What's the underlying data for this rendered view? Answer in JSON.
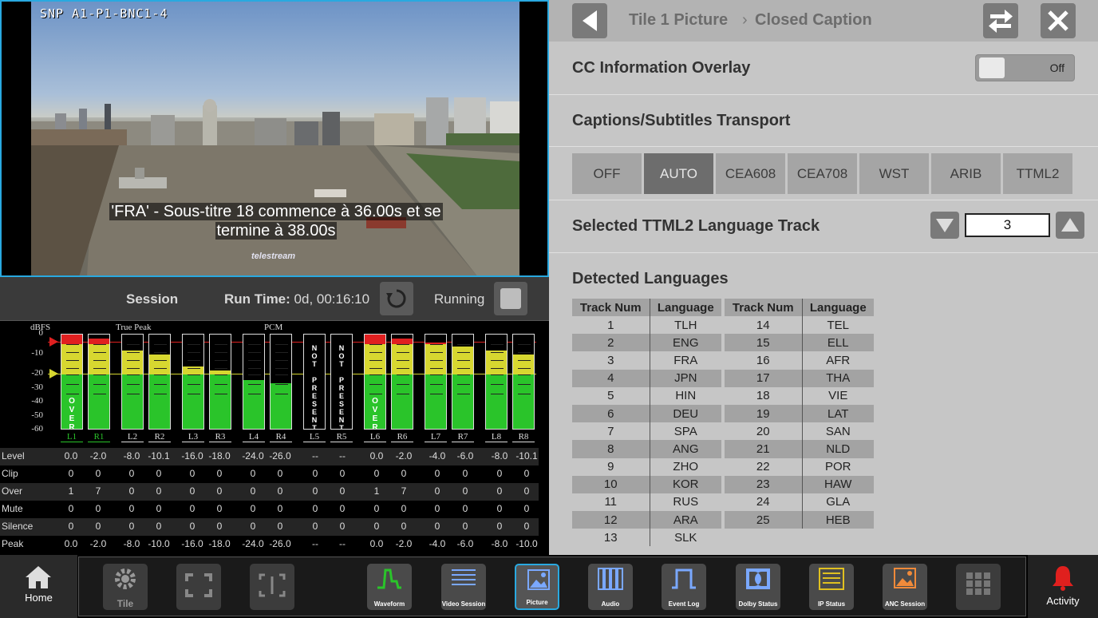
{
  "picture": {
    "source_label": "SNP A1-P1-BNC1-4",
    "caption_line1": "'FRA' - Sous-titre 18 commence à 36.00s et se",
    "caption_line2": "termine à 38.00s",
    "watermark": "telestream"
  },
  "session": {
    "title": "Session",
    "runtime_label": "Run Time:",
    "runtime_value": "0d, 00:16:10",
    "status": "Running"
  },
  "meters": {
    "unit_label": "dBFS",
    "group_true_peak": "True Peak",
    "group_pcm": "PCM",
    "scale": [
      "0",
      "-10",
      "-20",
      "-30",
      "-40",
      "-50",
      "-60"
    ],
    "over_text": "OVER",
    "not_present_text": "NOT PRESENT",
    "channels": [
      {
        "name": "L1",
        "level_db": 0.0,
        "over": true,
        "highlight": true
      },
      {
        "name": "R1",
        "level_db": -2.0,
        "over": false,
        "highlight": true
      },
      {
        "name": "L2",
        "level_db": -8.0,
        "over": false
      },
      {
        "name": "R2",
        "level_db": -10.1,
        "over": false
      },
      {
        "name": "L3",
        "level_db": -16.0,
        "over": false
      },
      {
        "name": "R3",
        "level_db": -18.0,
        "over": false
      },
      {
        "name": "L4",
        "level_db": -24.0,
        "over": false
      },
      {
        "name": "R4",
        "level_db": -26.0,
        "over": false
      },
      {
        "name": "L5",
        "level_db": null,
        "not_present": true
      },
      {
        "name": "R5",
        "level_db": null,
        "not_present": true
      },
      {
        "name": "L6",
        "level_db": 0.0,
        "over": true
      },
      {
        "name": "R6",
        "level_db": -2.0,
        "over": false
      },
      {
        "name": "L7",
        "level_db": -4.0,
        "over": false
      },
      {
        "name": "R7",
        "level_db": -6.0,
        "over": false
      },
      {
        "name": "L8",
        "level_db": -8.0,
        "over": false
      },
      {
        "name": "R8",
        "level_db": -10.1,
        "over": false
      }
    ],
    "stats": [
      {
        "name": "Level",
        "values": [
          "0.0",
          "-2.0",
          "-8.0",
          "-10.1",
          "-16.0",
          "-18.0",
          "-24.0",
          "-26.0",
          "--",
          "--",
          "0.0",
          "-2.0",
          "-4.0",
          "-6.0",
          "-8.0",
          "-10.1"
        ]
      },
      {
        "name": "Clip",
        "values": [
          "0",
          "0",
          "0",
          "0",
          "0",
          "0",
          "0",
          "0",
          "0",
          "0",
          "0",
          "0",
          "0",
          "0",
          "0",
          "0"
        ]
      },
      {
        "name": "Over",
        "values": [
          "1",
          "7",
          "0",
          "0",
          "0",
          "0",
          "0",
          "0",
          "0",
          "0",
          "1",
          "7",
          "0",
          "0",
          "0",
          "0"
        ]
      },
      {
        "name": "Mute",
        "values": [
          "0",
          "0",
          "0",
          "0",
          "0",
          "0",
          "0",
          "0",
          "0",
          "0",
          "0",
          "0",
          "0",
          "0",
          "0",
          "0"
        ]
      },
      {
        "name": "Silence",
        "values": [
          "0",
          "0",
          "0",
          "0",
          "0",
          "0",
          "0",
          "0",
          "0",
          "0",
          "0",
          "0",
          "0",
          "0",
          "0",
          "0"
        ]
      },
      {
        "name": "Peak",
        "values": [
          "0.0",
          "-2.0",
          "-8.0",
          "-10.0",
          "-16.0",
          "-18.0",
          "-24.0",
          "-26.0",
          "--",
          "--",
          "0.0",
          "-2.0",
          "-4.0",
          "-6.0",
          "-8.0",
          "-10.0"
        ]
      }
    ]
  },
  "panel": {
    "breadcrumb_parent": "Tile 1 Picture",
    "breadcrumb_sep": "›",
    "breadcrumb_current": "Closed Caption",
    "overlay_label": "CC Information Overlay",
    "overlay_toggle_state": "Off",
    "transport_label": "Captions/Subtitles Transport",
    "transport_options": [
      "OFF",
      "AUTO",
      "CEA608",
      "CEA708",
      "WST",
      "ARIB",
      "TTML2"
    ],
    "transport_selected": "AUTO",
    "ttml_track_label": "Selected TTML2 Language Track",
    "ttml_track_value": "3",
    "detected_label": "Detected Languages",
    "col_track": "Track Num",
    "col_language": "Language",
    "languages_left": [
      [
        "1",
        "TLH"
      ],
      [
        "2",
        "ENG"
      ],
      [
        "3",
        "FRA"
      ],
      [
        "4",
        "JPN"
      ],
      [
        "5",
        "HIN"
      ],
      [
        "6",
        "DEU"
      ],
      [
        "7",
        "SPA"
      ],
      [
        "8",
        "ANG"
      ],
      [
        "9",
        "ZHO"
      ],
      [
        "10",
        "KOR"
      ],
      [
        "11",
        "RUS"
      ],
      [
        "12",
        "ARA"
      ],
      [
        "13",
        "SLK"
      ]
    ],
    "languages_right": [
      [
        "14",
        "TEL"
      ],
      [
        "15",
        "ELL"
      ],
      [
        "16",
        "AFR"
      ],
      [
        "17",
        "THA"
      ],
      [
        "18",
        "VIE"
      ],
      [
        "19",
        "LAT"
      ],
      [
        "20",
        "SAN"
      ],
      [
        "21",
        "NLD"
      ],
      [
        "22",
        "POR"
      ],
      [
        "23",
        "HAW"
      ],
      [
        "24",
        "GLA"
      ],
      [
        "25",
        "HEB"
      ]
    ]
  },
  "nav": {
    "home": "Home",
    "tile": "Tile",
    "waveform": "Waveform",
    "video_session": "Video Session",
    "picture": "Picture",
    "audio": "Audio",
    "event_log": "Event Log",
    "dolby_status": "Dolby Status",
    "ip_status": "IP Status",
    "anc_session": "ANC Session",
    "activity": "Activity"
  },
  "colors": {
    "accent": "#29a9e0",
    "meter_red": "#e02020",
    "meter_yellow": "#d7d730",
    "meter_green": "#2ac42a",
    "alarm_red": "#e0201e"
  }
}
